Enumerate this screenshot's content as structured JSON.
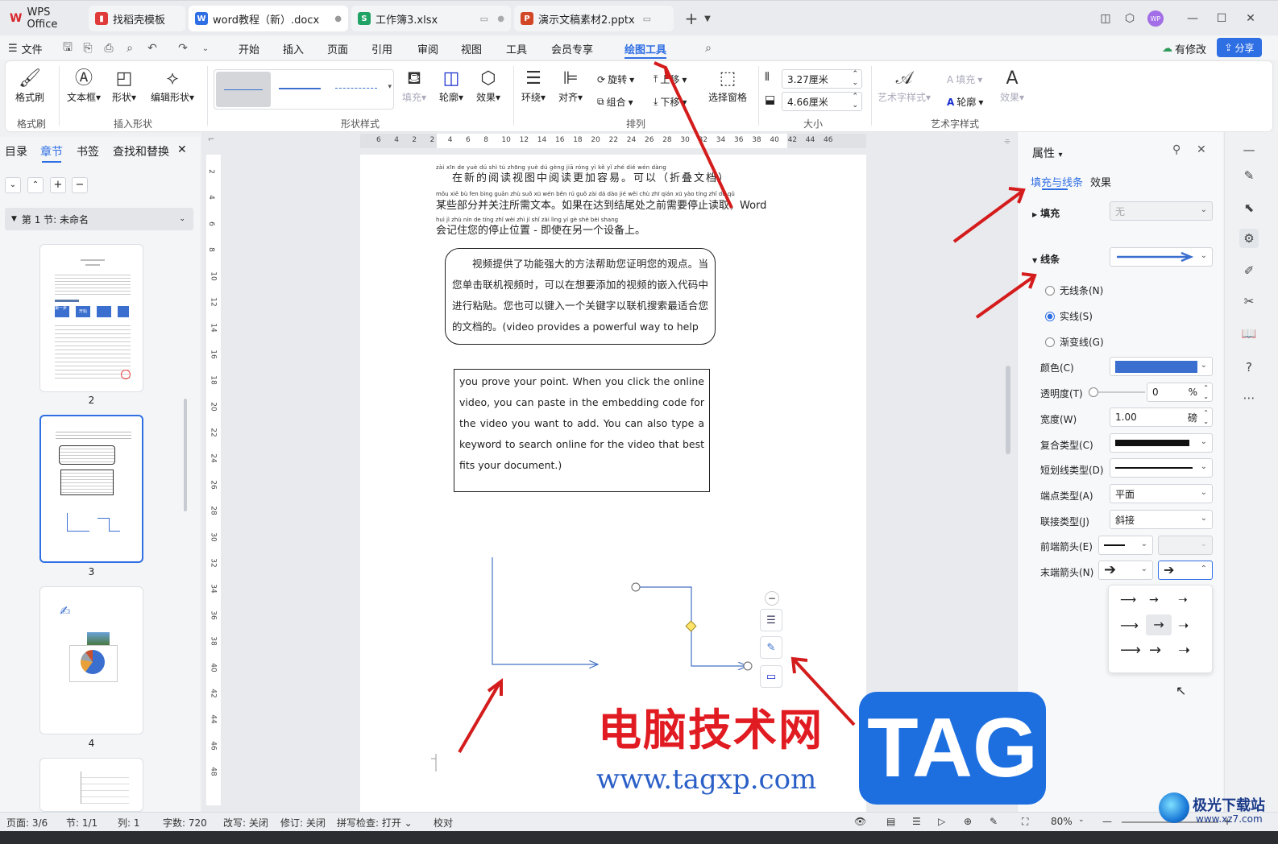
{
  "tabs": [
    {
      "label": "WPS Office",
      "icon": "wps-logo-icon"
    },
    {
      "label": "找稻壳模板",
      "icon": "docer-icon"
    },
    {
      "label": "word教程（新）.docx",
      "icon": "word-doc-icon"
    },
    {
      "label": "工作簿3.xlsx",
      "icon": "sheet-icon"
    },
    {
      "label": "演示文稿素材2.pptx",
      "icon": "presentation-icon"
    }
  ],
  "user_avatar": "WP",
  "menu": {
    "file": "文件",
    "items": [
      "开始",
      "插入",
      "页面",
      "引用",
      "审阅",
      "视图",
      "工具",
      "会员专享",
      "绘图工具"
    ],
    "active": "绘图工具",
    "has_changes": "有修改",
    "share": "分享"
  },
  "ribbon": {
    "format_brush": "格式刷",
    "group_format_brush": "格式刷",
    "textbox": "文本框",
    "shape": "形状",
    "edit_shape": "编辑形状",
    "group_insert_shape": "插入形状",
    "group_shape_style": "形状样式",
    "fill": "填充",
    "outline": "轮廓",
    "effect": "效果",
    "wrap": "环绕",
    "align": "对齐",
    "rotate": "旋转",
    "group": "组合",
    "move_up": "上移",
    "move_down": "下移",
    "selection_pane": "选择窗格",
    "group_arrange": "排列",
    "height": "3.27厘米",
    "width": "4.66厘米",
    "group_size": "大小",
    "art_style": "艺术字样式",
    "art_fill": "填充",
    "art_outline": "轮廓",
    "art_effect": "效果",
    "group_art": "艺术字样式"
  },
  "nav_panel": {
    "tabs": [
      "目录",
      "章节",
      "书签",
      "查找和替换"
    ],
    "active_tab": "章节",
    "section_title": "第 1 节: 未命名",
    "pages": [
      "2",
      "3",
      "4"
    ],
    "thumb2_block_labels": [
      "第一步",
      "开始"
    ]
  },
  "ruler": {
    "top": [
      "6",
      "4",
      "2",
      "2",
      "4",
      "6",
      "8",
      "10",
      "12",
      "14",
      "16",
      "18",
      "20",
      "22",
      "24",
      "26",
      "28",
      "30",
      "32",
      "34",
      "36",
      "38",
      "40",
      "42",
      "44",
      "46"
    ],
    "left": [
      "2",
      "4",
      "6",
      "8",
      "10",
      "12",
      "14",
      "16",
      "18",
      "20",
      "22",
      "24",
      "26",
      "28",
      "30",
      "32",
      "34",
      "36",
      "38",
      "40",
      "42",
      "44",
      "46",
      "48"
    ]
  },
  "document": {
    "pinyin1": "zài xīn de yuè dú shì tú zhōng yuè dú gèng jiā róng yì   kě yǐ   zhé dié wén dàng",
    "line1": "在新的阅读视图中阅读更加容易。可以（折叠文档）",
    "pinyin2": "mǒu xiē bù fen bìng guān zhù suǒ xū wén běn    rú guǒ zài dá dào jié wěi chù zhī qián xū yào tíng zhǐ dú qǔ",
    "line2": "某些部分并关注所需文本。如果在达到结尾处之前需要停止读取，Word",
    "pinyin3": "huì jì zhù nín de tíng zhǐ wèi zhì    jí shǐ zài lìng yí gè shè bèi shang",
    "line3": "会记住您的停止位置 - 即使在另一个设备上。",
    "box1": "视频提供了功能强大的方法帮助您证明您的观点。当您单击联机视频时，可以在想要添加的视频的嵌入代码中进行粘贴。您也可以键入一个关键字以联机搜索最适合您的文档的。(video provides a powerful way to help",
    "box2": "you prove your point. When you click the online video, you can paste in the embedding code for the video you want to add. You can also type a keyword to search online for the video that best fits your document.)"
  },
  "props": {
    "title": "属性",
    "tabs": [
      "填充与线条",
      "效果"
    ],
    "fill_label": "填充",
    "fill_value": "无",
    "line_label": "线条",
    "no_line": "无线条(N)",
    "solid": "实线(S)",
    "gradient": "渐变线(G)",
    "color_label": "颜色(C)",
    "color": "#3a6fcf",
    "transparency_label": "透明度(T)",
    "transparency_value": "0",
    "transparency_unit": "%",
    "width_label": "宽度(W)",
    "width_value": "1.00",
    "width_unit": "磅",
    "compound_label": "复合类型(C)",
    "dash_label": "短划线类型(D)",
    "cap_label": "端点类型(A)",
    "cap_value": "平面",
    "join_label": "联接类型(J)",
    "join_value": "斜接",
    "begin_arrow_label": "前端箭头(E)",
    "end_arrow_label": "末端箭头(N)"
  },
  "status": {
    "page": "页面: 3/6",
    "section": "节: 1/1",
    "column": "列: 1",
    "words": "字数: 720",
    "edit_mode": "改写: 关闭",
    "revision": "修订: 关闭",
    "spellcheck": "拼写检查: 打开",
    "proofread": "校对",
    "zoom": "80%"
  },
  "watermark": {
    "site_name": "电脑技术网",
    "url": "www.tagxp.com",
    "tag": "TAG",
    "corner_logo": "极光下载站",
    "corner_url": "www.xz7.com"
  }
}
